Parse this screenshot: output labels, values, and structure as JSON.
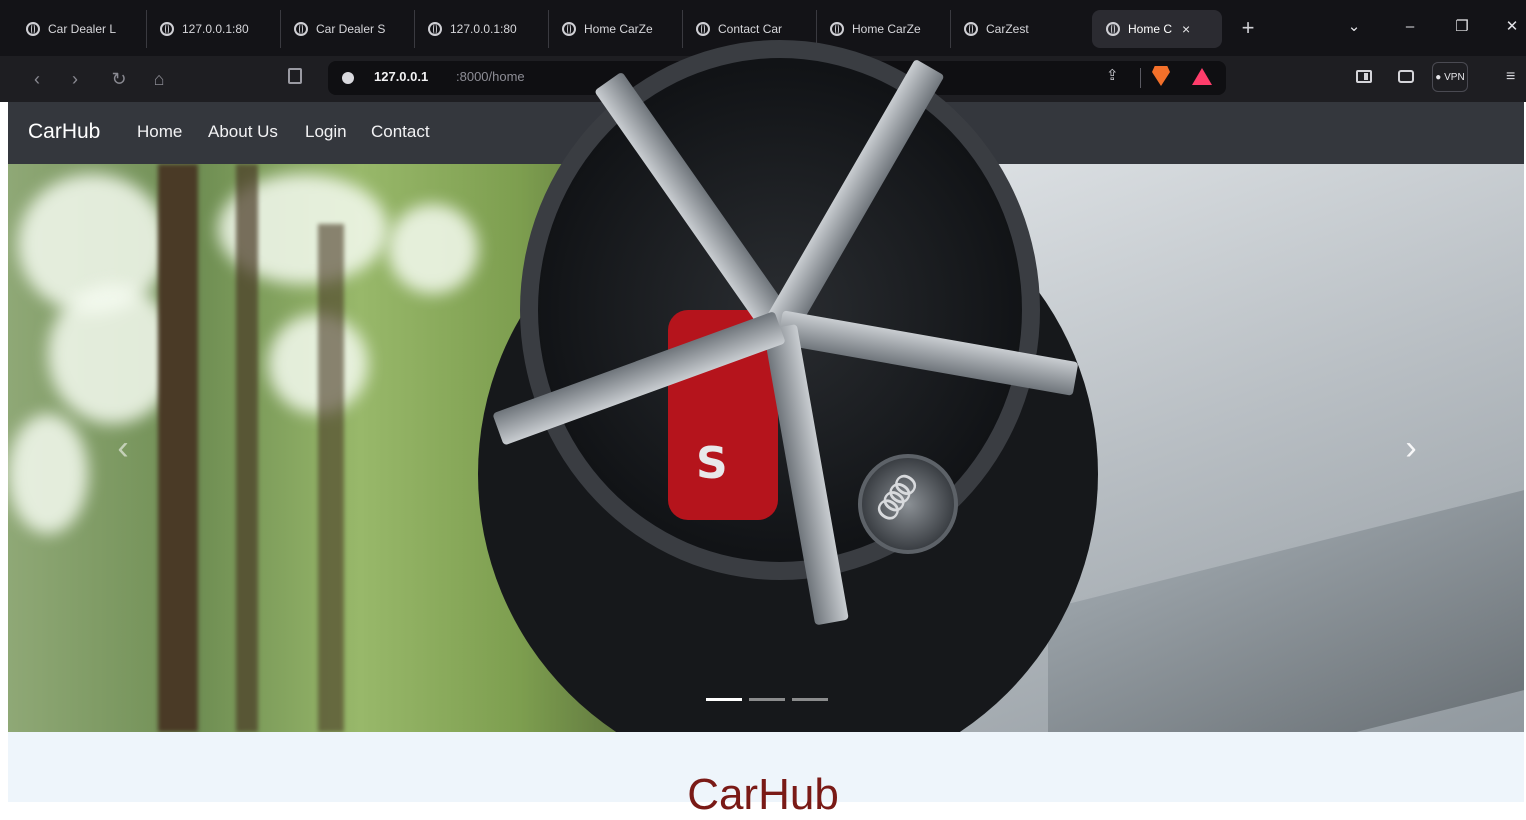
{
  "browser": {
    "tabs": [
      {
        "title": "Car Dealer L",
        "active": false
      },
      {
        "title": "127.0.0.1:80",
        "active": false
      },
      {
        "title": "Car Dealer S",
        "active": false
      },
      {
        "title": "127.0.0.1:80",
        "active": false
      },
      {
        "title": "Home CarZe",
        "active": false
      },
      {
        "title": "Contact Car",
        "active": false
      },
      {
        "title": "Home CarZe",
        "active": false
      },
      {
        "title": "CarZest",
        "active": false
      },
      {
        "title": "Home C",
        "active": true
      }
    ],
    "close_glyph": "×",
    "new_tab_glyph": "+",
    "window_controls": {
      "dropdown": "⌄",
      "minimize": "–",
      "maximize": "❐",
      "close": "✕"
    },
    "nav": {
      "back": "‹",
      "forward": "›",
      "reload": "↻",
      "home": "⌂"
    },
    "url": {
      "host": "127.0.0.1",
      "path": ":8000/home"
    },
    "vpn_label": "● VPN",
    "menu_glyph": "≡",
    "share_glyph": "⇪"
  },
  "site": {
    "brand": "CarHub",
    "nav_links": [
      "Home",
      "About Us",
      "Login",
      "Contact"
    ],
    "carousel": {
      "prev_glyph": "‹",
      "next_glyph": "›",
      "slide_count": 3,
      "active_slide": 1,
      "caliper_letter": "S",
      "hub_logo": "OOOO"
    },
    "section_title": "CarHub"
  },
  "icons": [
    "globe-icon",
    "close-icon",
    "plus-icon",
    "bookmark-icon",
    "site-info-icon",
    "share-icon",
    "brave-lion-icon",
    "rewards-triangle-icon",
    "sidebar-icon",
    "wallet-icon",
    "hamburger-menu-icon",
    "chevron-left-icon",
    "chevron-right-icon"
  ],
  "colors": {
    "browser_bg": "#131317",
    "navbar_bg": "#34373d",
    "section_bg": "#eef5fb",
    "section_title": "#7a1a16",
    "brave_orange": "#f3702a",
    "rewards_pink": "#ff3d6b"
  }
}
